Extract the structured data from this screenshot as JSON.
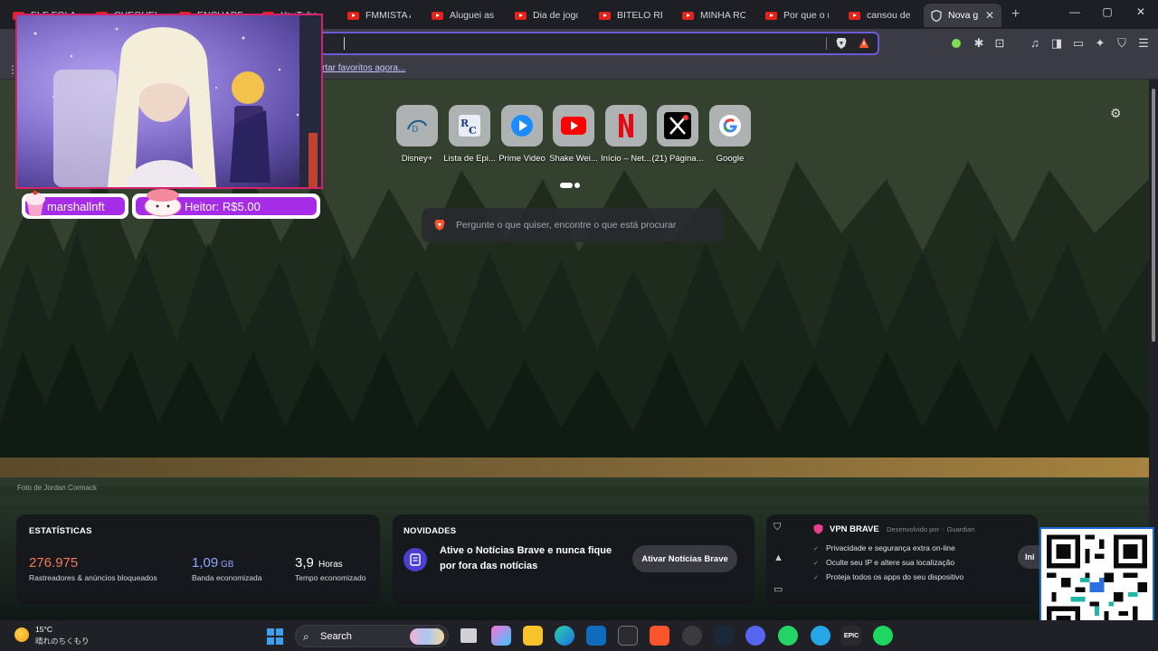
{
  "tabs": [
    {
      "label": "ELE FOLA VI"
    },
    {
      "label": "CHEGUEI NA"
    },
    {
      "label": "ENCHARDRE"
    },
    {
      "label": "YouTube"
    },
    {
      "label": "FMMISTA AT"
    },
    {
      "label": "Aluguei as N"
    },
    {
      "label": "Dia de jogo"
    },
    {
      "label": "BITELO REVE"
    },
    {
      "label": "MINHA ROT"
    },
    {
      "label": "Por que o m"
    },
    {
      "label": "cansou de s"
    },
    {
      "label": "Nova g"
    }
  ],
  "window": {
    "minimize": "—",
    "maximize": "▢",
    "close": "✕",
    "new_tab": "+"
  },
  "bookmarks": {
    "import_text": "rtar favoritos agora..."
  },
  "top_sites": [
    {
      "name": "Disney+",
      "icon": "disney-icon"
    },
    {
      "name": "Lista de Epi...",
      "icon": "rc-icon"
    },
    {
      "name": "Prime Video",
      "icon": "play-icon"
    },
    {
      "name": "Shake Wei...",
      "icon": "youtube-icon"
    },
    {
      "name": "Início – Net...",
      "icon": "netflix-icon"
    },
    {
      "name": "(21) Página...",
      "icon": "x-icon"
    },
    {
      "name": "Google",
      "icon": "google-icon"
    }
  ],
  "search": {
    "placeholder": "Pergunte o que quiser, encontre o que está procurar"
  },
  "photo_credit": "Foto de Jordan Cormack",
  "stats": {
    "title": "ESTATÍSTICAS",
    "trackers_value": "276.975",
    "trackers_label": "Rastreadores & anúncios bloqueados",
    "bandwidth_value": "1,09",
    "bandwidth_unit": "GB",
    "bandwidth_label": "Banda economizada",
    "time_value": "3,9",
    "time_unit": "Horas",
    "time_label": "Tempo economizado"
  },
  "news": {
    "title": "NOVIDADES",
    "text": "Ative o Notícias Brave e nunca fique por fora das notícias",
    "button": "Ativar Notícias Brave"
  },
  "vpn": {
    "title": "VPN BRAVE",
    "by": "Desenvolvido por",
    "partner": "Guardian",
    "items": [
      "Privacidade e segurança extra on-line",
      "Oculte seu IP e altere sua localização",
      "Proteja todos os apps do seu dispositivo"
    ],
    "button": "Ini"
  },
  "stream": {
    "alert_user": "marshallnft",
    "donation": "Heitor: R$5.00"
  },
  "taskbar": {
    "temperature": "15°C",
    "weather_text": "晴れのちくもり",
    "search_label": "Search",
    "epic_label": "EPIC"
  },
  "colors": {
    "accent": "#6c5bd8",
    "trackers": "#f27a56",
    "bandwidth": "#8fa6ff",
    "brave": "#fb542b",
    "vpn": "#e83f8a"
  }
}
